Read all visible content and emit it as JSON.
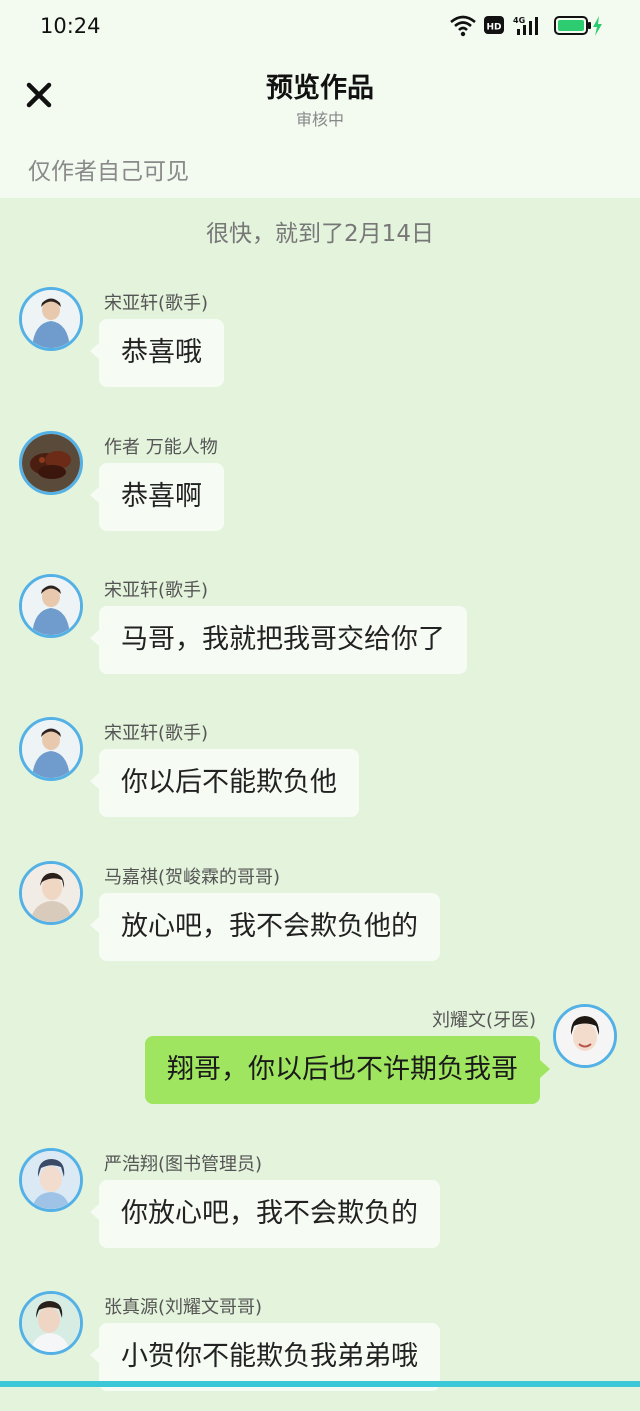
{
  "status_bar": {
    "time": "10:24",
    "icons": [
      "wifi-icon",
      "hd-icon",
      "4g-signal-icon",
      "battery-charging-icon"
    ],
    "hd_label": "HD",
    "network_label": "4G"
  },
  "header": {
    "close_icon": "close-icon",
    "title": "预览作品",
    "subtitle": "审核中",
    "visibility_note": "仅作者自己可见"
  },
  "chat": {
    "date_separator": "很快，就到了2月14日",
    "messages": [
      {
        "side": "left",
        "name": "宋亚轩(歌手)",
        "text": "恭喜哦",
        "avatar": "avatar-song"
      },
      {
        "side": "left",
        "name": "作者 万能人物",
        "text": "恭喜啊",
        "avatar": "avatar-author"
      },
      {
        "side": "left",
        "name": "宋亚轩(歌手)",
        "text": "马哥，我就把我哥交给你了",
        "avatar": "avatar-song"
      },
      {
        "side": "left",
        "name": "宋亚轩(歌手)",
        "text": "你以后不能欺负他",
        "avatar": "avatar-song"
      },
      {
        "side": "left",
        "name": "马嘉祺(贺峻霖的哥哥)",
        "text": "放心吧，我不会欺负他的",
        "avatar": "avatar-ma"
      },
      {
        "side": "right",
        "name": "刘耀文(牙医)",
        "text": "翔哥，你以后也不许期负我哥",
        "avatar": "avatar-liu"
      },
      {
        "side": "left",
        "name": "严浩翔(图书管理员)",
        "text": "你放心吧，我不会欺负的",
        "avatar": "avatar-yan"
      },
      {
        "side": "left",
        "name": "张真源(刘耀文哥哥)",
        "text": "小贺你不能欺负我弟弟哦",
        "avatar": "avatar-zhang"
      }
    ]
  },
  "colors": {
    "chat_background": "#e4f3dc",
    "header_background": "#f3fbf1",
    "incoming_bubble": "#f6fbf4",
    "outgoing_bubble": "#9fe55f",
    "avatar_ring": "#54b1e6",
    "battery_accent": "#2ecc71"
  }
}
